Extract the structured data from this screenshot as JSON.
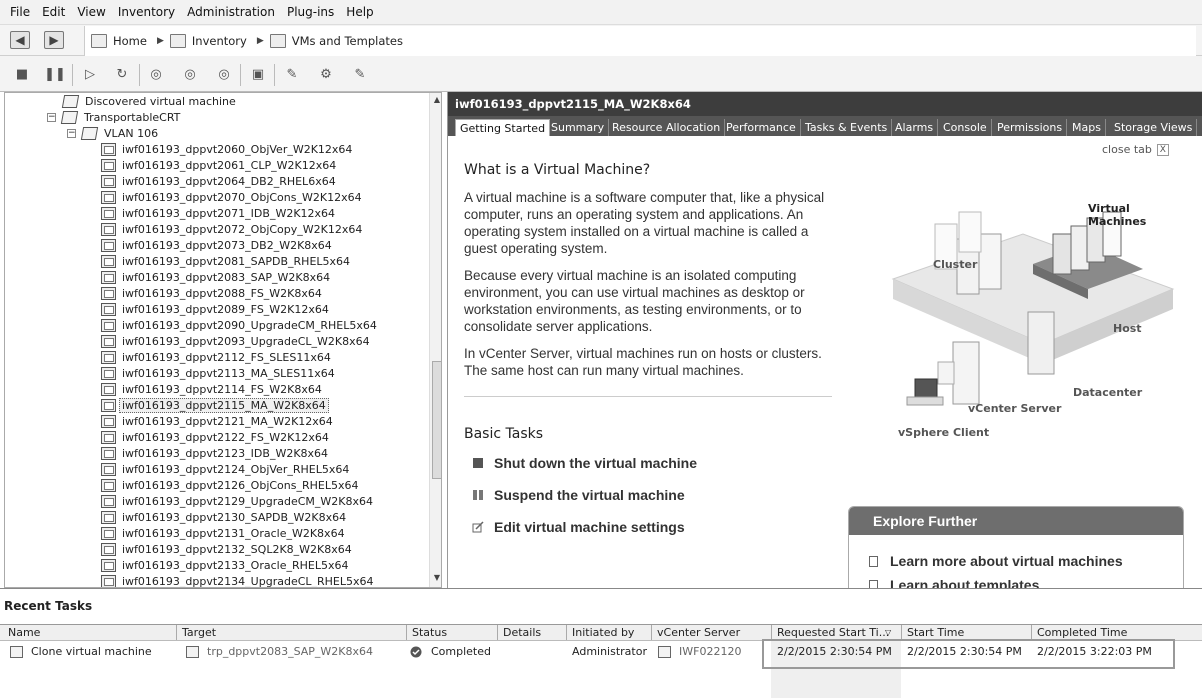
{
  "menu": [
    "File",
    "Edit",
    "View",
    "Inventory",
    "Administration",
    "Plug-ins",
    "Help"
  ],
  "breadcrumb": [
    "Home",
    "Inventory",
    "VMs and Templates"
  ],
  "tree": {
    "top_items": [
      {
        "label": "Discovered virtual machine",
        "level": 0
      },
      {
        "label": "TransportableCRT",
        "level": 0
      },
      {
        "label": "VLAN 106",
        "level": 1
      }
    ],
    "vms": [
      "iwf016193_dppvt2060_ObjVer_W2K12x64",
      "iwf016193_dppvt2061_CLP_W2K12x64",
      "iwf016193_dppvt2064_DB2_RHEL6x64",
      "iwf016193_dppvt2070_ObjCons_W2K12x64",
      "iwf016193_dppvt2071_IDB_W2K12x64",
      "iwf016193_dppvt2072_ObjCopy_W2K12x64",
      "iwf016193_dppvt2073_DB2_W2K8x64",
      "iwf016193_dppvt2081_SAPDB_RHEL5x64",
      "iwf016193_dppvt2083_SAP_W2K8x64",
      "iwf016193_dppvt2088_FS_W2K8x64",
      "iwf016193_dppvt2089_FS_W2K12x64",
      "iwf016193_dppvt2090_UpgradeCM_RHEL5x64",
      "iwf016193_dppvt2093_UpgradeCL_W2K8x64",
      "iwf016193_dppvt2112_FS_SLES11x64",
      "iwf016193_dppvt2113_MA_SLES11x64",
      "iwf016193_dppvt2114_FS_W2K8x64",
      "iwf016193_dppvt2115_MA_W2K8x64",
      "iwf016193_dppvt2121_MA_W2K12x64",
      "iwf016193_dppvt2122_FS_W2K12x64",
      "iwf016193_dppvt2123_IDB_W2K8x64",
      "iwf016193_dppvt2124_ObjVer_RHEL5x64",
      "iwf016193_dppvt2126_ObjCons_RHEL5x64",
      "iwf016193_dppvt2129_UpgradeCM_W2K8x64",
      "iwf016193_dppvt2130_SAPDB_W2K8x64",
      "iwf016193_dppvt2131_Oracle_W2K8x64",
      "iwf016193_dppvt2132_SQL2K8_W2K8x64",
      "iwf016193_dppvt2133_Oracle_RHEL5x64",
      "iwf016193_dppvt2134_UpgradeCL_RHEL5x64"
    ],
    "selected": "iwf016193_dppvt2115_MA_W2K8x64"
  },
  "vm_title": "iwf016193_dppvt2115_MA_W2K8x64",
  "tabs": [
    "Getting Started",
    "Summary",
    "Resource Allocation",
    "Performance",
    "Tasks & Events",
    "Alarms",
    "Console",
    "Permissions",
    "Maps",
    "Storage Views"
  ],
  "active_tab": "Getting Started",
  "close_tab": "close tab",
  "getting_started": {
    "heading": "What is a Virtual Machine?",
    "paragraphs": [
      "A virtual machine is a software computer that, like a physical computer, runs an operating system and applications. An operating system installed on a virtual machine is called a guest operating system.",
      "Because every virtual machine is an isolated computing environment, you can use virtual machines as desktop or workstation environments, as testing environments, or to consolidate server applications.",
      "In vCenter Server, virtual machines run on hosts or clusters. The same host can run many virtual machines."
    ],
    "basic_tasks_title": "Basic Tasks",
    "tasks": [
      "Shut down the virtual machine",
      "Suspend the virtual machine",
      "Edit virtual machine settings"
    ],
    "diagram_labels": {
      "virtual_machines": "Virtual Machines",
      "cluster": "Cluster",
      "host": "Host",
      "vcenter_server": "vCenter Server",
      "datacenter": "Datacenter",
      "vsphere_client": "vSphere Client"
    },
    "explore_title": "Explore Further",
    "explore_links": [
      "Learn more about virtual machines",
      "Learn about templates"
    ]
  },
  "recent_tasks": {
    "title": "Recent Tasks",
    "columns": [
      "Name",
      "Target",
      "Status",
      "Details",
      "Initiated by",
      "vCenter Server",
      "Requested Start Ti...",
      "Start Time",
      "Completed Time"
    ],
    "rows": [
      {
        "name": "Clone virtual machine",
        "target": "trp_dppvt2083_SAP_W2K8x64",
        "status": "Completed",
        "details": "",
        "initiated_by": "Administrator",
        "vcenter_server": "IWF022120",
        "requested_start": "2/2/2015 2:30:54 PM",
        "start_time": "2/2/2015 2:30:54 PM",
        "completed_time": "2/2/2015 3:22:03 PM"
      }
    ]
  }
}
